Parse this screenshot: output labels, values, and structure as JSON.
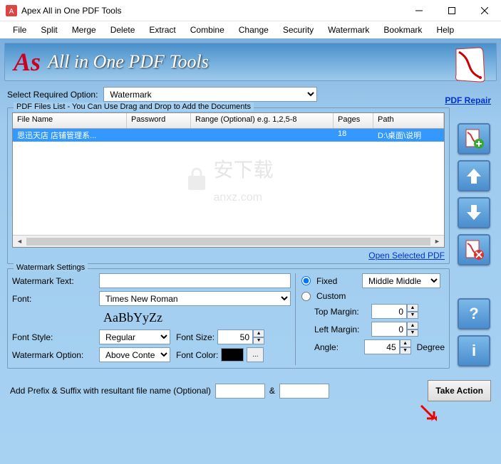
{
  "window": {
    "title": "Apex All in One PDF Tools"
  },
  "menu": [
    "File",
    "Split",
    "Merge",
    "Delete",
    "Extract",
    "Combine",
    "Change",
    "Security",
    "Watermark",
    "Bookmark",
    "Help"
  ],
  "banner": {
    "logo": "As",
    "text": "All in One PDF Tools"
  },
  "links": {
    "pdf_repair": "PDF Repair",
    "open_selected": "Open Selected PDF"
  },
  "select_option": {
    "label": "Select Required Option:",
    "value": "Watermark"
  },
  "files_list": {
    "legend": "PDF Files List - You Can Use Drag and Drop to Add the Documents",
    "columns": [
      "File Name",
      "Password",
      "Range (Optional) e.g. 1,2,5-8",
      "Pages",
      "Path"
    ],
    "rows": [
      {
        "file": "思迅天店 店铺管理系...",
        "password": "",
        "range": "",
        "pages": "18",
        "path": "D:\\桌面\\说明"
      }
    ]
  },
  "watermark": {
    "legend": "Watermark Settings",
    "text_label": "Watermark Text:",
    "text_value": "",
    "font_label": "Font:",
    "font_value": "Times New Roman",
    "font_preview": "AaBbYyZz",
    "font_style_label": "Font Style:",
    "font_style_value": "Regular",
    "font_size_label": "Font Size:",
    "font_size_value": "50",
    "option_label": "Watermark Option:",
    "option_value": "Above Content",
    "font_color_label": "Font Color:",
    "position": {
      "fixed_label": "Fixed",
      "custom_label": "Custom",
      "fixed_value": "Middle Middle",
      "top_margin_label": "Top Margin:",
      "top_margin_value": "0",
      "left_margin_label": "Left Margin:",
      "left_margin_value": "0",
      "angle_label": "Angle:",
      "angle_value": "45",
      "degree_label": "Degree"
    }
  },
  "bottom": {
    "prefix_label": "Add Prefix & Suffix with resultant file name (Optional)",
    "amp": "&",
    "take_action": "Take Action"
  }
}
